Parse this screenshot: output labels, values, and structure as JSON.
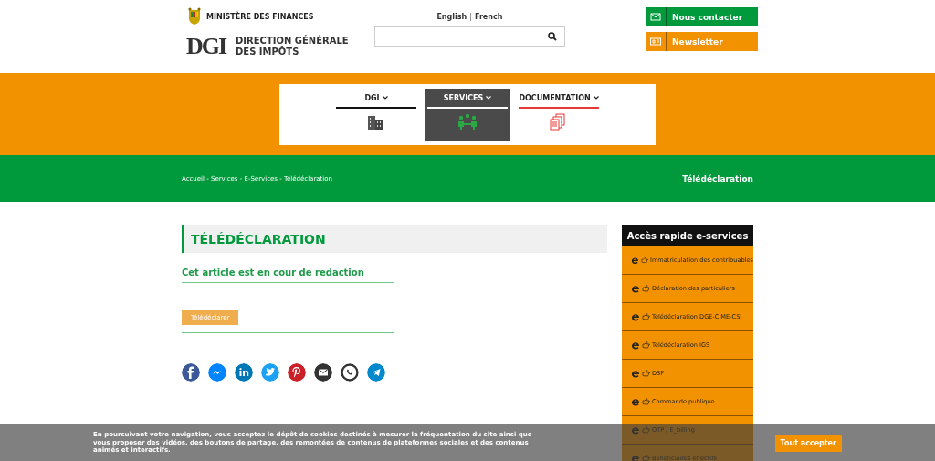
{
  "header": {
    "ministry": "MINISTÈRE DES FINANCES",
    "logo_text": "DGI",
    "org_name": [
      "DIRECTION GÉNÉRALE",
      "DES IMPÔTS"
    ],
    "languages": [
      {
        "label": "English"
      },
      {
        "label": "French"
      }
    ],
    "language_separator": "|",
    "buttons": [
      {
        "label": "Nous contacter",
        "kind": "contact",
        "color": "#009a3d"
      },
      {
        "label": "Newsletter",
        "kind": "newsletter",
        "color": "#f39200"
      }
    ]
  },
  "nav": [
    {
      "label": "DGI",
      "selected": false,
      "color": "#111111",
      "kind": "buildings"
    },
    {
      "label": "SERVICES",
      "selected": true,
      "color": "#ffffff",
      "kind": "people"
    },
    {
      "label": "DOCUMENTATION",
      "selected": false,
      "color": "#e53935",
      "kind": "documents"
    }
  ],
  "breadcrumb": "Accueil - Services - E-Services - Télédéclaration",
  "banner_title": "Télédéclaration",
  "article": {
    "title": "TÉLÉDÉCLARATION",
    "subtitle": "Cet article est en cour de redaction",
    "button": "Télédéclarer",
    "share": [
      {
        "kind": "facebook",
        "color": "#3b5998"
      },
      {
        "kind": "messenger",
        "color": "#0084ff"
      },
      {
        "kind": "linkedin",
        "color": "#0077b5"
      },
      {
        "kind": "twitter",
        "color": "#1da1f2"
      },
      {
        "kind": "pinterest",
        "color": "#cb2027"
      },
      {
        "kind": "email",
        "color": "#333333"
      },
      {
        "kind": "whatsapp",
        "color": "#333333"
      },
      {
        "kind": "telegram",
        "color": "#0088cc"
      }
    ]
  },
  "sidebar": {
    "title": "Accès rapide e-services",
    "items": [
      "Immatriculation des contribuables",
      "Déclaration des particuliers",
      "Télédéclaration DGE-CIME-CSI",
      "Télédéclaration IGS",
      "DSF",
      "Commande publique",
      "OTP / E_billing",
      "Bénéficiaires effectifs"
    ]
  },
  "cookie_banner": {
    "text": "En poursuivant votre navigation, vous acceptez le dépôt de cookies destinés à mesurer la fréquentation du site ainsi que vous proposer des vidéos, des boutons de partage, des remontées de contenus de plateformes sociales et des contenus animés et interactifs.",
    "button": "Tout accepter"
  }
}
